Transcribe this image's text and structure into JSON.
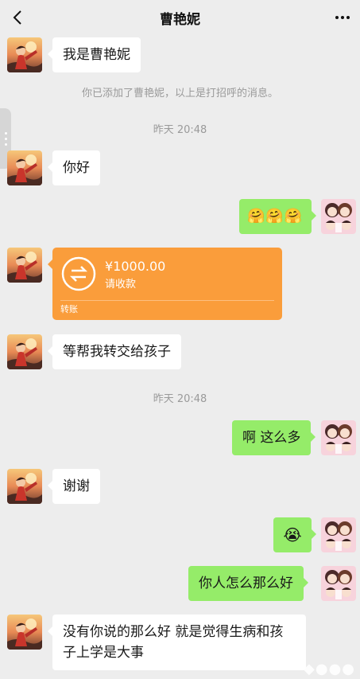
{
  "header": {
    "title": "曹艳妮",
    "back_icon": "chevron-left-icon",
    "more_icon": "more-dots-icon"
  },
  "messages": {
    "m1": "我是曹艳妮",
    "sys_added": "你已添加了曹艳妮，以上是打招呼的消息。",
    "time1": "昨天 20:48",
    "m2": "你好",
    "m3_emoji": "🤗🤗🤗",
    "transfer": {
      "amount": "¥1000.00",
      "status": "请收款",
      "kind": "转账"
    },
    "m4": "等帮我转交给孩子",
    "time2": "昨天 20:48",
    "m5": "啊 这么多",
    "m6": "谢谢",
    "m7_emoji": "😭",
    "m8": "你人怎么那么好",
    "m9": "没有你说的那么好  就是觉得生病和孩子上学是大事"
  },
  "colors": {
    "bg": "#ededed",
    "out_bubble": "#95ec69",
    "in_bubble": "#ffffff",
    "transfer": "#fa9d3b"
  }
}
